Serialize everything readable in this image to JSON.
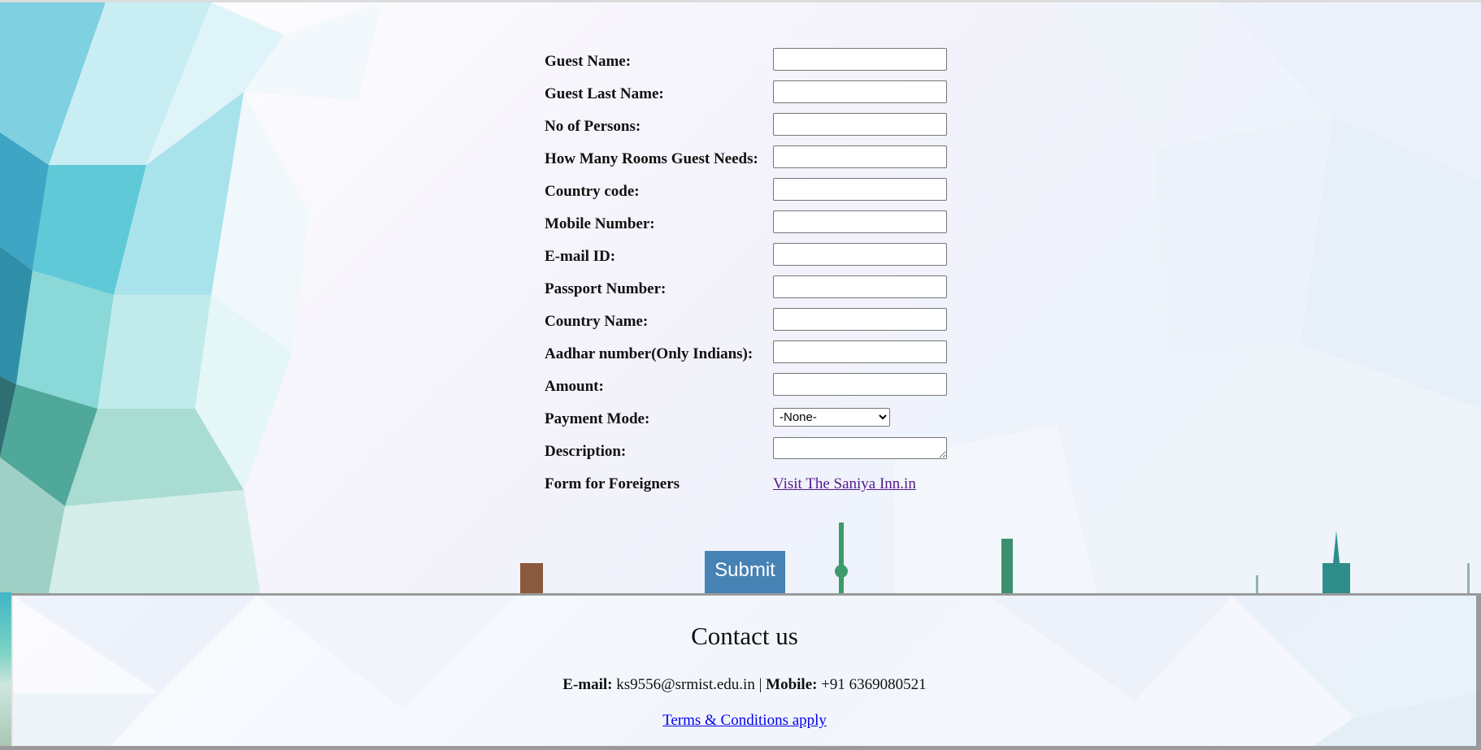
{
  "form": {
    "fields": [
      {
        "label": "Guest Name:",
        "value": ""
      },
      {
        "label": "Guest Last Name:",
        "value": ""
      },
      {
        "label": "No of Persons:",
        "value": ""
      },
      {
        "label": "How Many Rooms Guest Needs:",
        "value": ""
      },
      {
        "label": "Country code:",
        "value": ""
      },
      {
        "label": "Mobile Number:",
        "value": ""
      },
      {
        "label": "E-mail ID:",
        "value": ""
      },
      {
        "label": "Passport Number:",
        "value": ""
      },
      {
        "label": "Country Name:",
        "value": ""
      },
      {
        "label": "Aadhar number(Only Indians):",
        "value": ""
      },
      {
        "label": "Amount:",
        "value": ""
      }
    ],
    "payment_mode": {
      "label": "Payment Mode:",
      "selected": "-None-"
    },
    "description": {
      "label": "Description:",
      "value": ""
    },
    "foreigners": {
      "label": "Form for Foreigners",
      "link_text": "Visit The Saniya Inn.in"
    },
    "submit_label": "Submit"
  },
  "footer": {
    "title": "Contact us",
    "email_label": "E-mail:",
    "email_value": "ks9556@srmist.edu.in",
    "separator": "|",
    "mobile_label": "Mobile:",
    "mobile_value": "+91 6369080521",
    "terms_link": "Terms & Conditions apply"
  },
  "colors": {
    "submit_bg": "#4682b4",
    "visited_link": "#551a8b",
    "link": "#0000ee"
  }
}
